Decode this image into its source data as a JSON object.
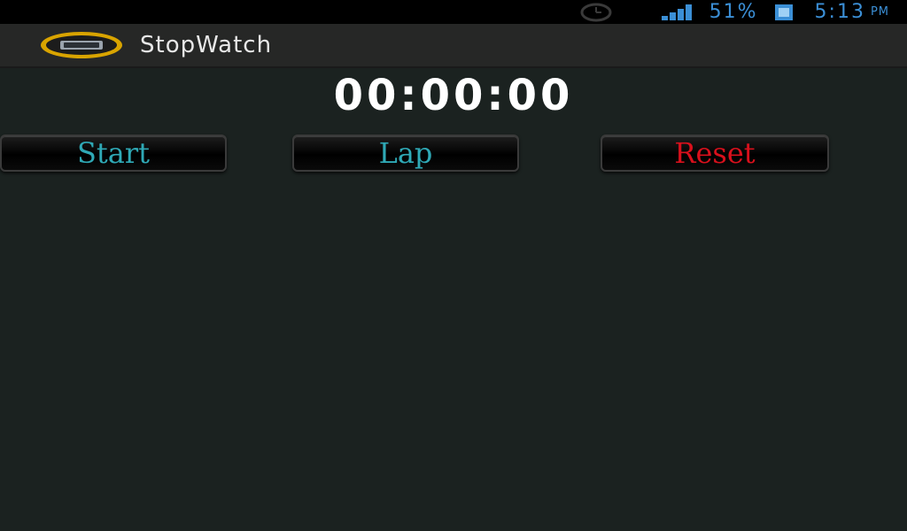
{
  "status_bar": {
    "battery_percent": "51%",
    "time": "5:13",
    "ampm": "PM",
    "icons": [
      "alarm-icon",
      "signal-icon",
      "battery-icon"
    ],
    "accent_color": "#3b8fd6"
  },
  "action_bar": {
    "app_title": "StopWatch",
    "icon": "stopwatch-app-icon"
  },
  "timer": {
    "display": "00:00:00"
  },
  "buttons": {
    "start_label": "Start",
    "lap_label": "Lap",
    "reset_label": "Reset",
    "start_color": "#2fa9b6",
    "lap_color": "#2fa9b6",
    "reset_color": "#d8101c"
  }
}
